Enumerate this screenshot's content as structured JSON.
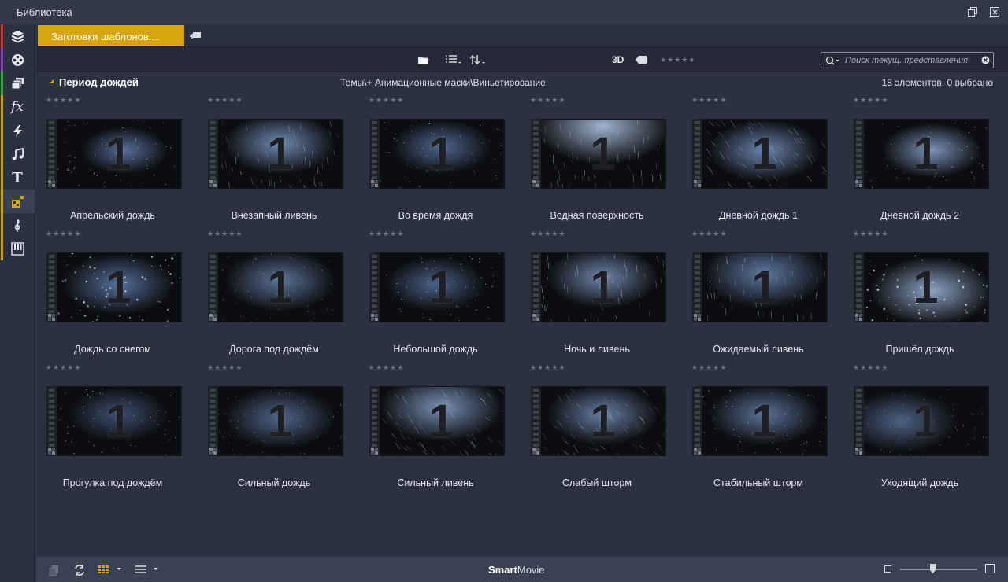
{
  "window": {
    "title": "Библиотека"
  },
  "colors": {
    "accent": "#d7a30f",
    "background": "#2b3140",
    "toolbar": "#252a36",
    "bottombar": "#3a4152"
  },
  "sidebar": {
    "items": [
      {
        "icon": "box-icon",
        "bar": "#d9342b"
      },
      {
        "icon": "film-reel-icon",
        "bar": "#8a3bc7"
      },
      {
        "icon": "clips-icon",
        "bar": "#2fa53a"
      },
      {
        "icon": "fx-icon",
        "glyph": "fx",
        "bar": "#d7a30f"
      },
      {
        "icon": "lightning-icon",
        "bar": "#d7a30f"
      },
      {
        "icon": "music-note-icon",
        "bar": "#d7a30f"
      },
      {
        "icon": "text-icon",
        "glyph": "T",
        "bar": "#d7a30f"
      },
      {
        "icon": "templates-icon",
        "bar": "#d7a30f",
        "active": true
      },
      {
        "icon": "treble-clef-icon",
        "bar": "#d7a30f"
      },
      {
        "icon": "piano-icon",
        "bar": "#d7a30f"
      }
    ]
  },
  "tabs": {
    "active_label": "Заготовки шаблонов:..."
  },
  "toolbar": {
    "label_3d": "3D"
  },
  "search": {
    "placeholder": "Поиск текущ. представления"
  },
  "header": {
    "title": "Период дождей",
    "path": "Темы\\+ Анимационные маски\\Виньетирование",
    "count": "18 элементов, 0 выбрано"
  },
  "items": [
    {
      "label": "Апрельский дождь"
    },
    {
      "label": "Внезапный ливень"
    },
    {
      "label": "Во время дождя"
    },
    {
      "label": "Водная поверхность"
    },
    {
      "label": "Дневной дождь 1"
    },
    {
      "label": "Дневной дождь 2"
    },
    {
      "label": "Дождь со снегом"
    },
    {
      "label": "Дорога под дождём"
    },
    {
      "label": "Небольшой дождь"
    },
    {
      "label": "Ночь и ливень"
    },
    {
      "label": "Ожидаемый ливень"
    },
    {
      "label": "Пришёл дождь"
    },
    {
      "label": "Прогулка под дождём"
    },
    {
      "label": "Сильный дождь"
    },
    {
      "label": "Сильный ливень"
    },
    {
      "label": "Слабый шторм"
    },
    {
      "label": "Стабильный шторм"
    },
    {
      "label": "Уходящий дождь"
    }
  ],
  "thumb_number": "1",
  "bottombar": {
    "brand_bold": "Smart",
    "brand_rest": "Movie"
  }
}
